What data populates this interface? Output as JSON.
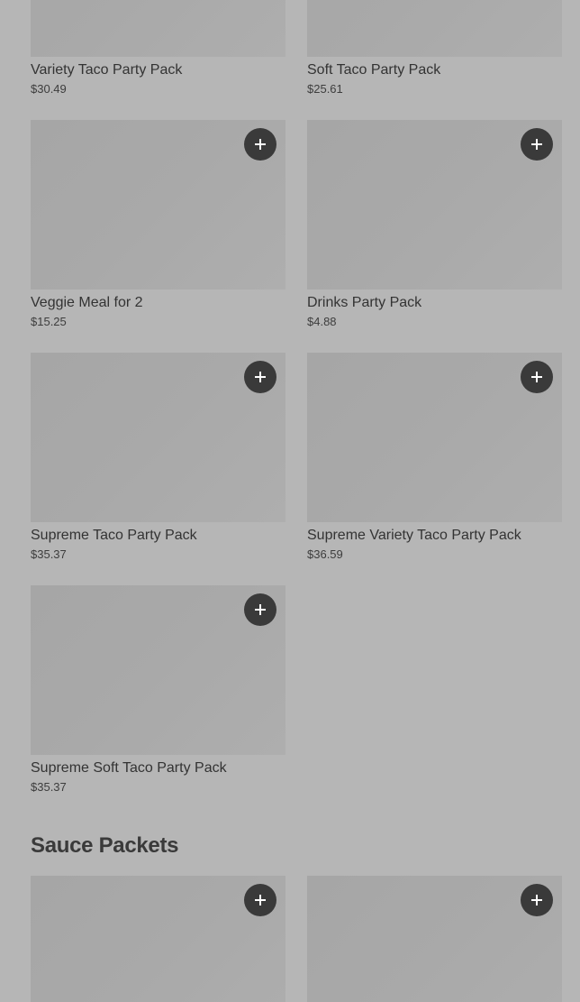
{
  "items_row0": [
    {
      "name": "Variety Taco Party Pack",
      "price": "$30.49"
    },
    {
      "name": "Soft Taco Party Pack",
      "price": "$25.61"
    }
  ],
  "items": [
    {
      "name": "Veggie Meal for 2",
      "price": "$15.25"
    },
    {
      "name": "Drinks Party Pack",
      "price": "$4.88"
    },
    {
      "name": "Supreme Taco Party Pack",
      "price": "$35.37"
    },
    {
      "name": "Supreme Variety Taco Party Pack",
      "price": "$36.59"
    },
    {
      "name": "Supreme Soft Taco Party Pack",
      "price": "$35.37"
    }
  ],
  "section": {
    "title": "Sauce Packets"
  },
  "icons": {
    "add": "plus-icon"
  },
  "colors": {
    "add_button": "#3a3a3a",
    "background": "#b6b6b6"
  }
}
